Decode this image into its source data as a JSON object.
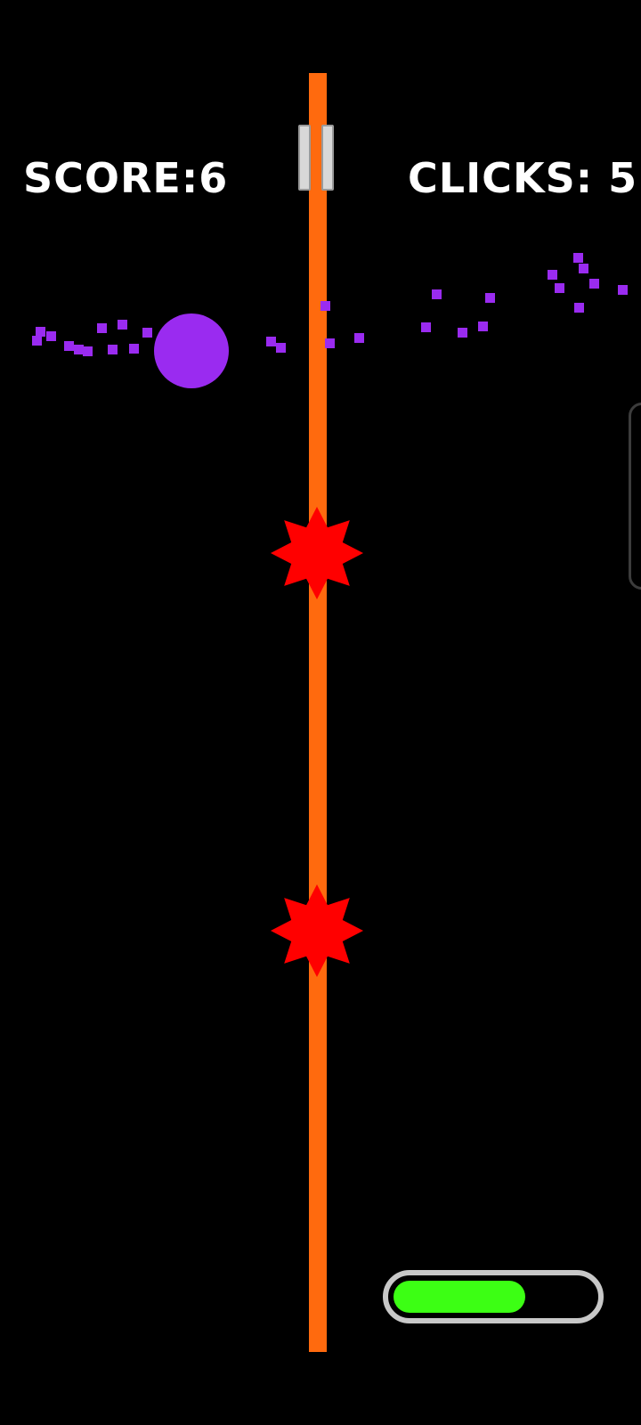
{
  "hud": {
    "score_text": "SCORE:6",
    "clicks_text": "CLICKS: 5"
  },
  "power_meter": {
    "fill_fraction": 0.66
  },
  "icons": {
    "pause": "pause-icon",
    "hazard": "red-spiky-star-icon"
  },
  "colors": {
    "background": "#000000",
    "pole": "#ff6a0e",
    "player": "#9a2bf0",
    "hazard": "#ff0000",
    "power_fill": "#3cff14",
    "power_frame": "#c8c8c8",
    "hud_text": "#ffffff"
  }
}
